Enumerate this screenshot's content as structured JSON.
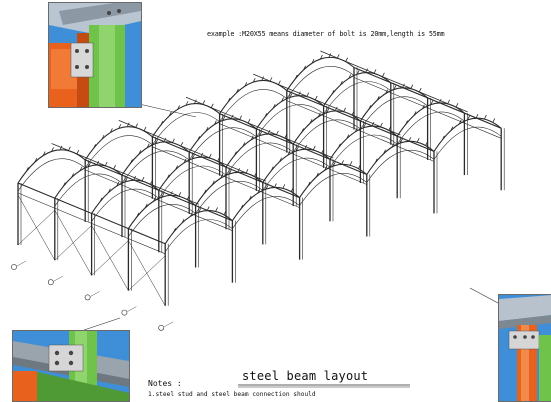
{
  "example_text": "example :M20X55 means diameter of bolt is 20mm,length is 55mm",
  "title": "steel beam layout",
  "notes": {
    "heading": "Notes :",
    "lines": [
      "1.steel stud and steel beam connection should"
    ]
  },
  "colors": {
    "steel_line": "#2a2a2a",
    "column_orange": "#e8621e",
    "beam_green": "#6fc24a",
    "sky_blue": "#3f8fd8",
    "beam_grey": "#9aa4ad",
    "connection_plate": "#d6d6d6"
  },
  "insets": [
    {
      "name": "connection-detail-top-left",
      "depicts": "orange column with green beam and bolted plate"
    },
    {
      "name": "connection-detail-bottom-left",
      "depicts": "blue beam on green stud with bolted plate"
    },
    {
      "name": "connection-detail-bottom-right",
      "depicts": "grey beam with orange column connection"
    }
  ]
}
